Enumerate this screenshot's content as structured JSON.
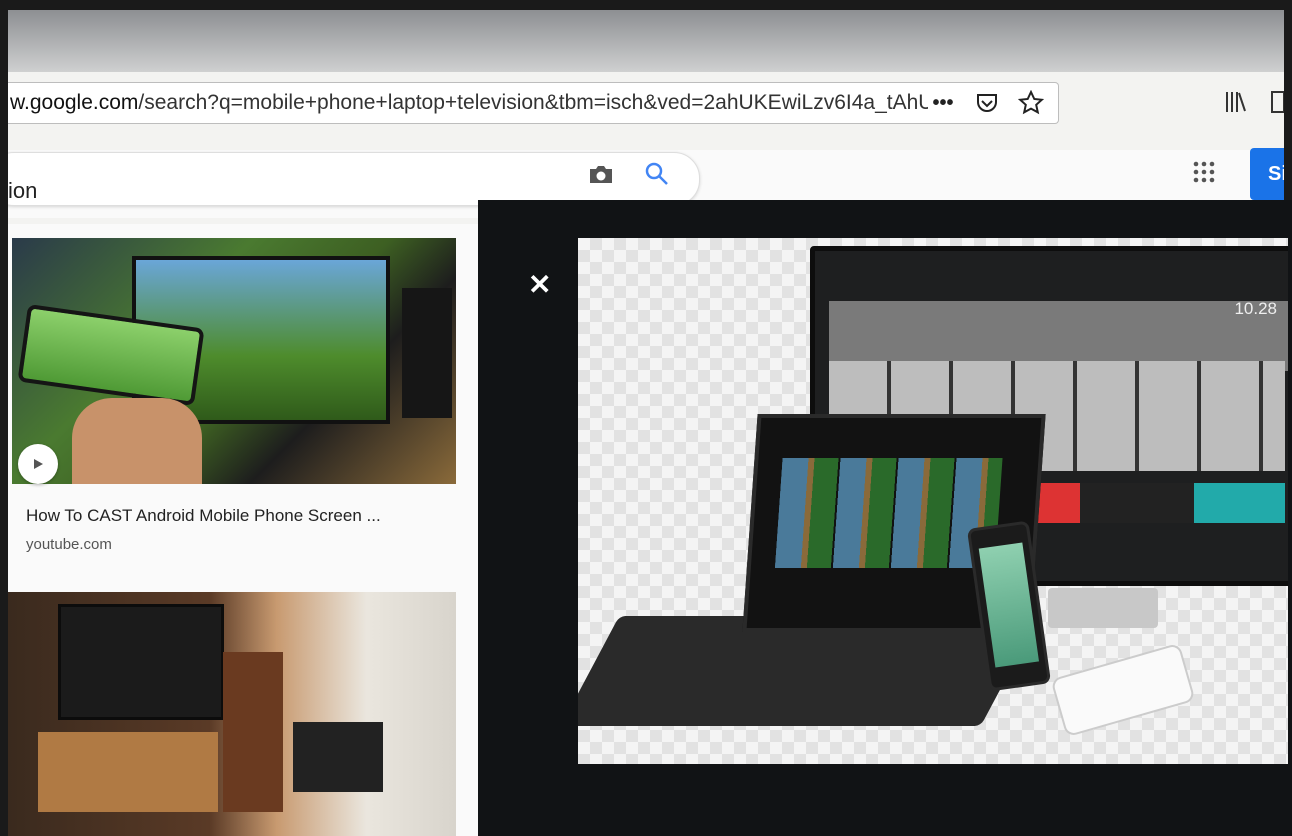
{
  "browser": {
    "url_host": "w.google.com",
    "url_path": "/search?q=mobile+phone+laptop+television&tbm=isch&ved=2ahUKEwiLzv6I4a_tAhU",
    "more_label": "•••"
  },
  "search": {
    "query_fragment": "ion",
    "signin_label": "Si"
  },
  "results": [
    {
      "title": "How To CAST Android Mobile Phone Screen ...",
      "source": "youtube.com"
    }
  ],
  "preview": {
    "close_label": "✕",
    "clock": "10.28"
  },
  "colors": {
    "accent": "#1a73e8",
    "preview_bg": "#111315"
  }
}
